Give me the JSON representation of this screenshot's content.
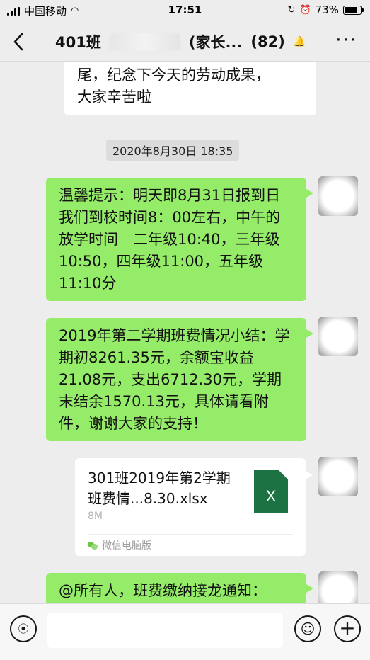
{
  "status_bar": {
    "carrier": "中国移动",
    "time": "17:51",
    "battery": "73%",
    "battery_level": 0.73
  },
  "nav": {
    "back_icon": "chevron-left-icon",
    "title_prefix": "401班",
    "title_suffix": "(家长...",
    "member_count": "(82)",
    "more_icon": "more-dots-icon"
  },
  "messages": {
    "partial_top": "尾，纪念下今天的劳动成果，\n大家辛苦啦",
    "timestamp": "2020年8月30日 18:35",
    "notice": "温馨提示：明天即8月31日报到日我们到校时间8：00左右，中午的放学时间　二年级10:40，三年级10:50，四年级11:00，五年级11:10分",
    "summary": "2019年第二学期班费情况小结：学期初8261.35元，余额宝收益21.08元，支出6712.30元，学期末结余1570.13元，具体请看附件，谢谢大家的支持！",
    "file": {
      "name": "301班2019年第2学期班费情...8.30.xlsx",
      "size": "8M",
      "icon_letter": "X",
      "source": "微信电脑版"
    },
    "last": "@所有人，班费缴纳接龙通知："
  },
  "input_bar": {
    "voice_icon": "voice-icon",
    "emoji_icon": "emoji-icon",
    "plus_icon": "plus-icon",
    "input_value": ""
  },
  "colors": {
    "outgoing_bubble": "#95ec69",
    "background": "#ededed",
    "excel_green": "#1d7244"
  }
}
